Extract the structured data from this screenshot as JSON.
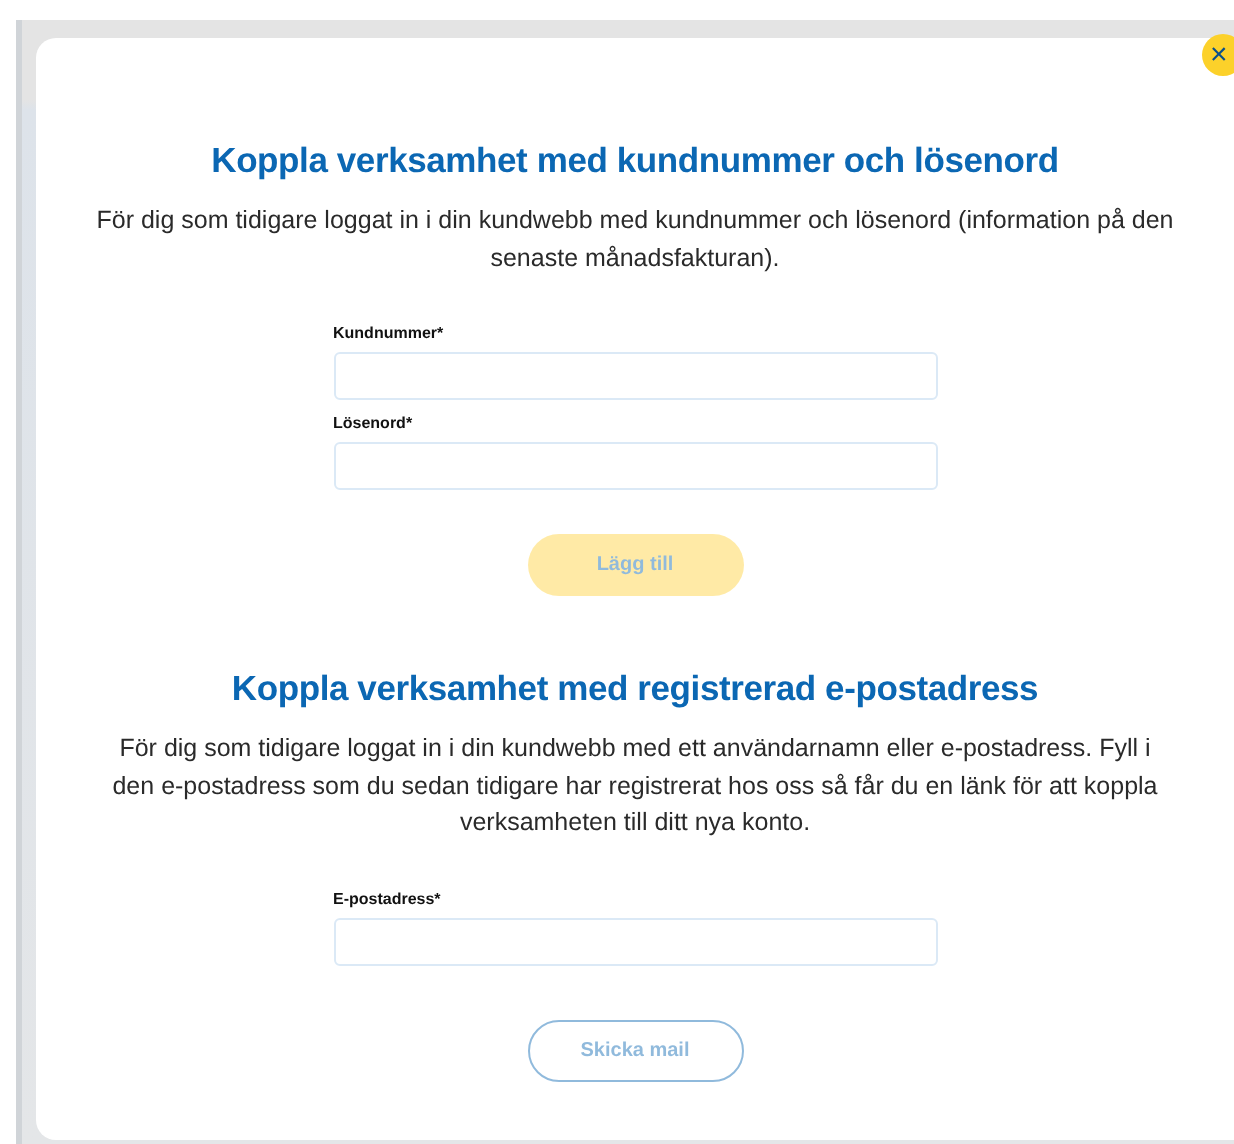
{
  "close_button": {
    "label": "×"
  },
  "sections": [
    {
      "title": "Koppla verksamhet med kundnummer och lösenord",
      "description": "För dig som tidigare loggat in i din kundwebb med kundnummer och lösenord (information på den senaste månadsfakturan).",
      "fields": [
        {
          "label": "Kundnummer*"
        },
        {
          "label": "Lösenord*"
        }
      ],
      "button": {
        "label": "Lägg till",
        "kind": "primary",
        "disabled": true
      }
    },
    {
      "title": "Koppla verksamhet med registrerad e-postadress",
      "description": "För dig som tidigare loggat in i din kundwebb med ett användarnamn eller e-postadress. Fyll i den e-postadress som du sedan tidigare har registrerat hos oss så får du en länk för att koppla verksamheten till ditt nya konto.",
      "fields": [
        {
          "label": "E-postadress*"
        }
      ],
      "button": {
        "label": "Skicka mail",
        "kind": "secondary",
        "disabled": true
      }
    }
  ]
}
